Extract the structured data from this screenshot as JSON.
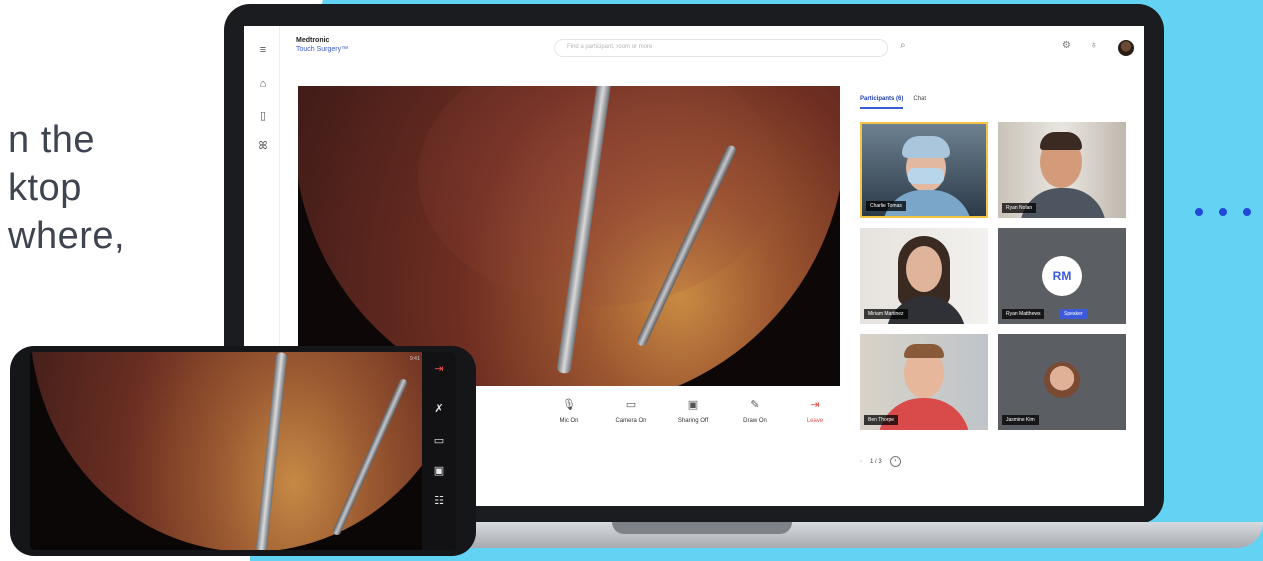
{
  "promo": {
    "lines": [
      "n the",
      "ktop",
      "where,"
    ]
  },
  "app": {
    "brand_name": "Medtronic",
    "room_name": "Touch Surgery™",
    "search_placeholder": "Find a participant, room or more",
    "tabs": [
      {
        "label": "Participants (6)",
        "active": true
      },
      {
        "label": "Chat",
        "active": false
      }
    ],
    "controls": [
      {
        "label": "Mic On",
        "icon": "mic-icon"
      },
      {
        "label": "Camera On",
        "icon": "camera-icon"
      },
      {
        "label": "Sharing Off",
        "icon": "screen-share-icon"
      },
      {
        "label": "Draw On",
        "icon": "draw-icon"
      },
      {
        "label": "Leave",
        "icon": "leave-icon"
      }
    ],
    "participants": [
      {
        "name": "Charlie Tomas",
        "kind": "video"
      },
      {
        "name": "Ryan Nolan",
        "kind": "video"
      },
      {
        "name": "Miriam Martinez",
        "kind": "video"
      },
      {
        "name": "Ryan Matthews",
        "initials": "RM",
        "badge": "Speaker",
        "kind": "initials"
      },
      {
        "name": "Ben Thorpe",
        "kind": "video"
      },
      {
        "name": "Jasmine Kim",
        "kind": "avatar"
      }
    ],
    "pager": "1 / 3"
  },
  "phone": {
    "status": "9:41"
  },
  "colors": {
    "background_accent": "#63d3f3",
    "dots": "#1f49d6",
    "brand_blue": "#3b5bdb",
    "leave_red": "#e4524f"
  }
}
